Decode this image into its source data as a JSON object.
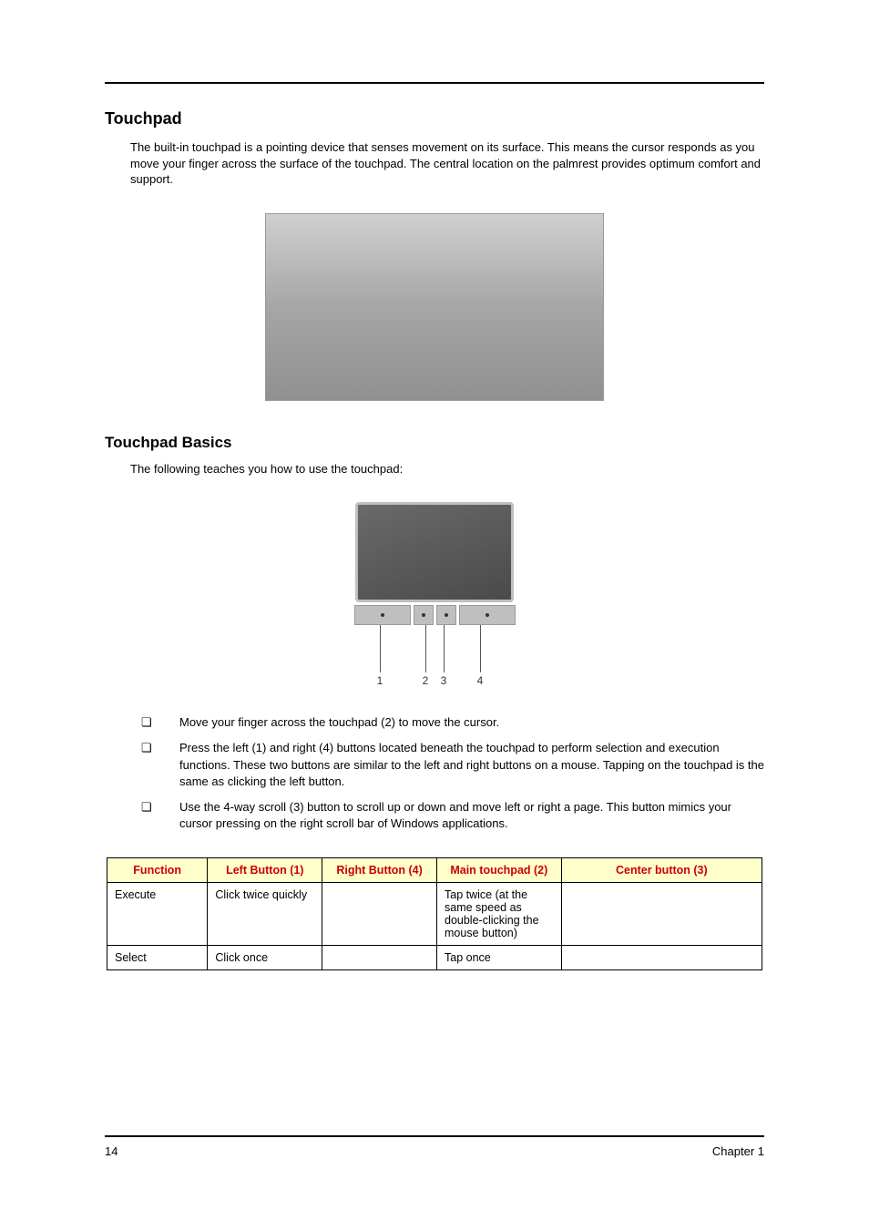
{
  "sections": {
    "touchpad": {
      "heading": "Touchpad",
      "paragraph": "The built-in touchpad is a pointing device that senses movement on its surface. This means the cursor responds as you move your finger across the surface of the touchpad. The central location on the palmrest provides optimum comfort and support."
    },
    "basics": {
      "heading": "Touchpad Basics",
      "paragraph": "The following teaches you how to use the touchpad:",
      "diagram_labels": {
        "l1": "1",
        "l2": "2",
        "l3": "3",
        "l4": "4"
      },
      "bullets": [
        "Move your finger across the touchpad (2) to move the cursor.",
        "Press the left (1) and right (4) buttons located beneath the touchpad to perform selection and execution functions. These two buttons are similar to the left and right buttons on a mouse. Tapping on the touchpad is the same as clicking the left button.",
        "Use the 4-way scroll (3) button to scroll up or down and move left or right a page. This button mimics your cursor pressing on the right scroll bar of Windows applications."
      ]
    }
  },
  "chart_data": {
    "type": "table",
    "headers": [
      "Function",
      "Left Button (1)",
      "Right Button (4)",
      "Main touchpad (2)",
      "Center button (3)"
    ],
    "rows": [
      {
        "function": "Execute",
        "left": "Click twice quickly",
        "right": "",
        "main": "Tap twice (at the same speed as double-clicking the mouse button)",
        "center": ""
      },
      {
        "function": "Select",
        "left": "Click once",
        "right": "",
        "main": "Tap once",
        "center": ""
      }
    ]
  },
  "footer": {
    "page": "14",
    "chapter": "Chapter 1"
  }
}
